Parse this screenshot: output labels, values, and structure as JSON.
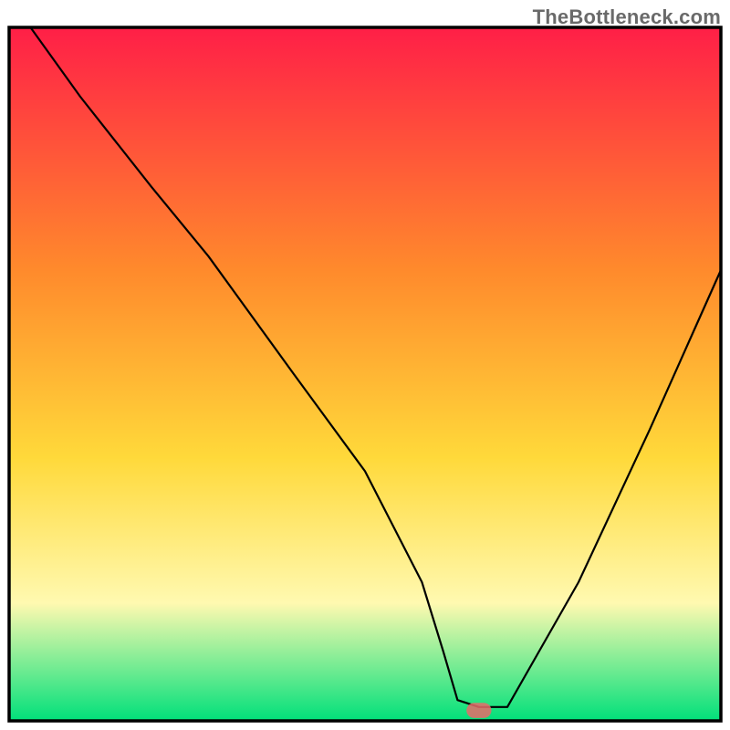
{
  "watermark": "TheBottleneck.com",
  "chart_data": {
    "type": "line",
    "title": "",
    "xlabel": "",
    "ylabel": "",
    "xlim": [
      0,
      100
    ],
    "ylim": [
      0,
      100
    ],
    "grid": false,
    "legend": false,
    "background_gradient": {
      "top": "#ff1f47",
      "mid_high": "#ff8a2c",
      "mid": "#ffd93a",
      "mid_low": "#fff9b0",
      "bottom": "#00e07a"
    },
    "series": [
      {
        "name": "bottleneck-curve",
        "x": [
          3,
          10,
          20,
          28,
          40,
          50,
          58,
          61,
          63,
          66,
          70,
          80,
          90,
          100
        ],
        "values": [
          100,
          90,
          77,
          67,
          50,
          36,
          20,
          10,
          3,
          2,
          2,
          20,
          42,
          65
        ]
      }
    ],
    "marker": {
      "x": 66.0,
      "y": 1.5,
      "width": 3.5,
      "height": 2.2,
      "rx": 1.1
    }
  }
}
